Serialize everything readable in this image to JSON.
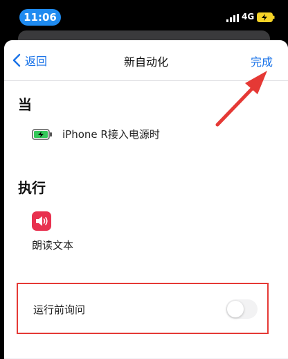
{
  "status_bar": {
    "time": "11:06",
    "network": "4G"
  },
  "nav": {
    "back_label": "返回",
    "title": "新自动化",
    "done_label": "完成"
  },
  "when": {
    "heading": "当",
    "trigger_label": "iPhone R接入电源时"
  },
  "do": {
    "heading": "执行",
    "action_label": "朗读文本"
  },
  "ask_before_running": {
    "label": "运行前询问",
    "enabled": false
  },
  "colors": {
    "accent": "#1a73e8",
    "time_pill": "#1f8bf0",
    "action_icon": "#e8314f",
    "highlight": "#e53935",
    "battery_charge": "#34c759"
  },
  "icons": {
    "back": "chevron-left-icon",
    "trigger": "battery-charging-icon",
    "action": "speaker-icon"
  }
}
